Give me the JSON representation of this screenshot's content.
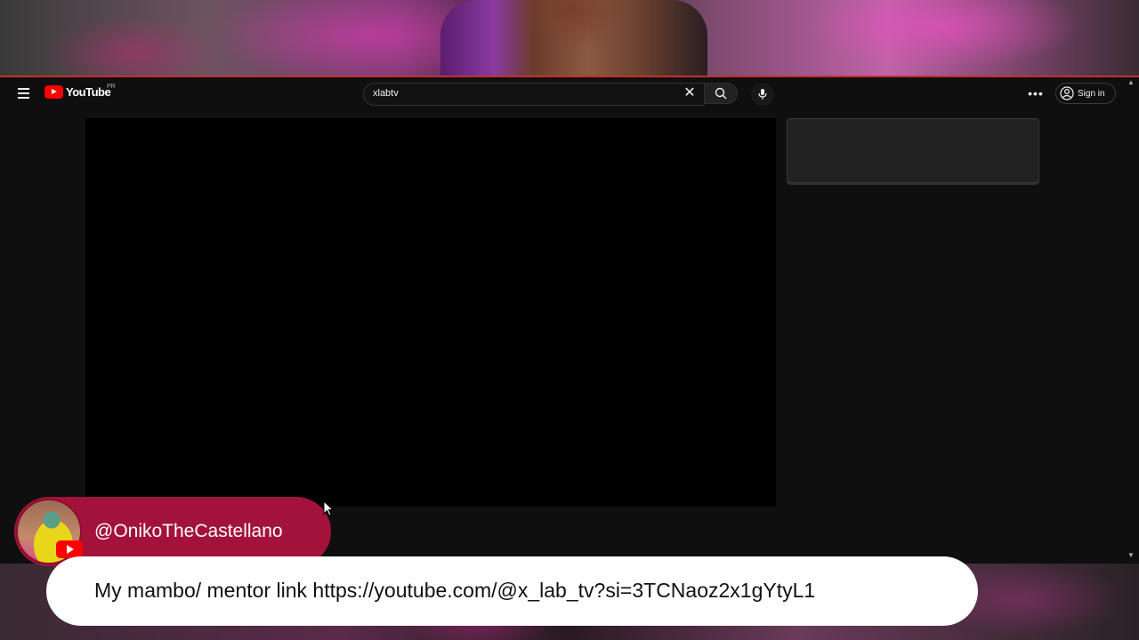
{
  "masthead": {
    "logo_text": "YouTube",
    "country_code": "PR",
    "search": {
      "value": "xlabtv",
      "placeholder": "Search"
    },
    "signin_label": "Sign in",
    "icons": [
      "menu-icon",
      "youtube-logo-icon",
      "clear-icon",
      "search-icon",
      "mic-icon",
      "more-icon",
      "account-icon"
    ]
  },
  "overlay": {
    "handle": "@OnikoTheCastellano",
    "link_text": "My mambo/ mentor link https://youtube.com/@x_lab_tv?si=3TCNaoz2x1gYtyL1"
  },
  "colors": {
    "background": "#0f0f0f",
    "brand_red": "#ff0000",
    "name_tag": "#a3123a",
    "link_box": "#ffffff"
  }
}
